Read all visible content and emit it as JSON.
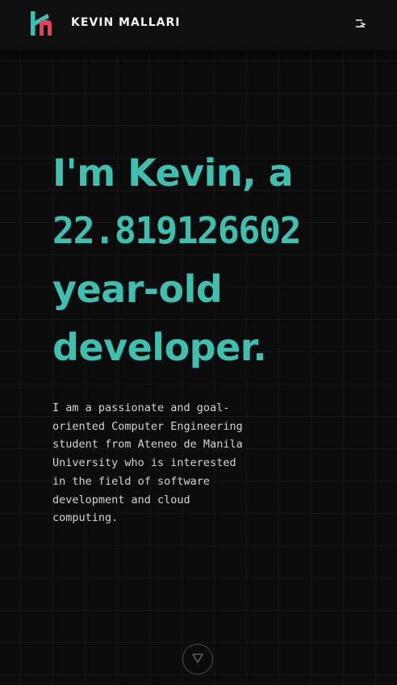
{
  "header": {
    "brand": "KEVIN MALLARI",
    "logo_colors": {
      "primary": "#3ebfb0",
      "secondary": "#ee3b5e"
    },
    "menu_icon": "menu-arrow-icon"
  },
  "hero": {
    "line1": "I'm Kevin, a",
    "age": "22.819126602",
    "line3": "year-old",
    "line4": "developer."
  },
  "bio": {
    "text": "I am a passionate and goal-oriented Computer Engineering student from Ateneo de Manila University who is interested in the field of software development and cloud computing."
  },
  "scroll": {
    "icon": "triangle-down-icon"
  },
  "colors": {
    "accent": "#3ebfb0",
    "background": "#0c0c0c",
    "text": "#d4d4d4"
  }
}
